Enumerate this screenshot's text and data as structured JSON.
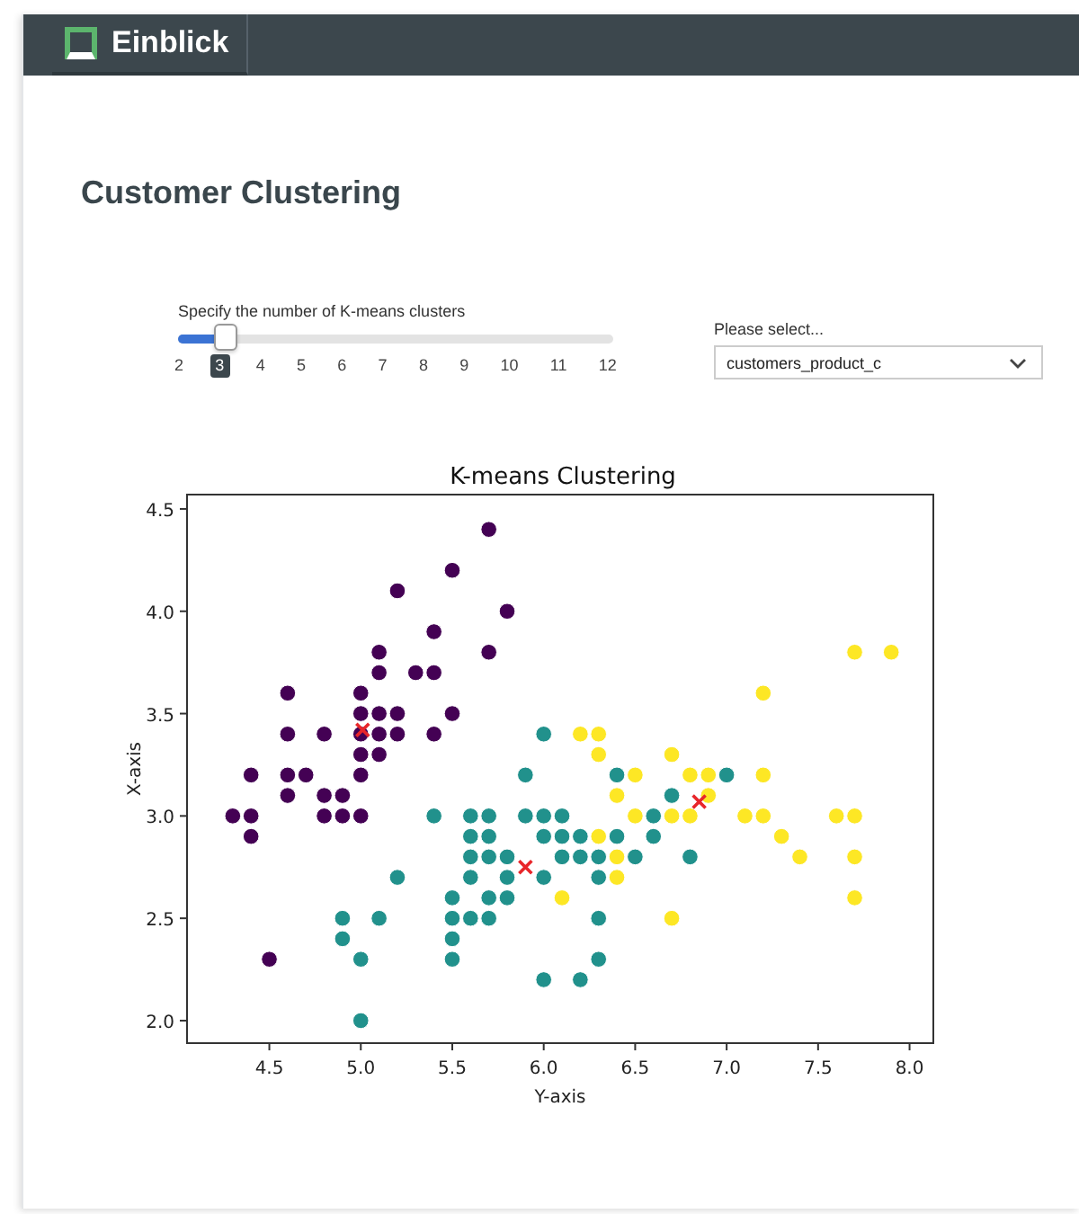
{
  "header": {
    "brand": "Einblick"
  },
  "page": {
    "title": "Customer Clustering"
  },
  "slider": {
    "label": "Specify the number of K-means clusters",
    "level": 0.1,
    "ticks": [
      {
        "label": "2",
        "selected": false
      },
      {
        "label": "3",
        "selected": true
      },
      {
        "label": "4",
        "selected": false
      },
      {
        "label": "5",
        "selected": false
      },
      {
        "label": "6",
        "selected": false
      },
      {
        "label": "7",
        "selected": false
      },
      {
        "label": "8",
        "selected": false
      },
      {
        "label": "9",
        "selected": false
      },
      {
        "label": "10",
        "selected": false
      },
      {
        "label": "11",
        "selected": false
      },
      {
        "label": "12",
        "selected": false
      }
    ]
  },
  "dropdown": {
    "label": "Please select...",
    "value": "customers_product_c"
  },
  "chart": {
    "chart_data": {
      "type": "scatter",
      "title": "K-means Clustering",
      "xlabel": "Y-axis",
      "ylabel": "X-axis",
      "xlim": [
        4.05,
        8.13
      ],
      "ylim": [
        1.89,
        4.57
      ],
      "xticks": [
        {
          "value": 4.5,
          "label": "4.5"
        },
        {
          "value": 5,
          "label": "5.0"
        },
        {
          "value": 5.5,
          "label": "5.5"
        },
        {
          "value": 6,
          "label": "6.0"
        },
        {
          "value": 6.5,
          "label": "6.5"
        },
        {
          "value": 7,
          "label": "7.0"
        },
        {
          "value": 7.5,
          "label": "7.5"
        },
        {
          "value": 8,
          "label": "8.0"
        }
      ],
      "yticks": [
        {
          "value": 2,
          "label": "2.0"
        },
        {
          "value": 2.5,
          "label": "2.5"
        },
        {
          "value": 3,
          "label": "3.0"
        },
        {
          "value": 3.5,
          "label": "3.5"
        },
        {
          "value": 4,
          "label": "4.0"
        },
        {
          "value": 4.5,
          "label": "4.5"
        }
      ],
      "series": [
        {
          "marker": "o",
          "color": "#440154",
          "x": [
            4.3,
            4.4,
            4.4,
            4.4,
            4.5,
            4.6,
            4.6,
            4.6,
            4.6,
            4.7,
            4.8,
            4.8,
            4.8,
            4.9,
            4.9,
            5.0,
            5.0,
            5.0,
            5.0,
            5.0,
            5.0,
            5.1,
            5.1,
            5.1,
            5.1,
            5.1,
            5.2,
            5.2,
            5.2,
            5.3,
            5.4,
            5.4,
            5.4,
            5.5,
            5.5,
            5.7,
            5.7,
            5.8
          ],
          "values": [
            3.0,
            3.0,
            2.9,
            3.2,
            2.3,
            3.6,
            3.4,
            3.2,
            3.1,
            3.2,
            3.4,
            3.1,
            3.0,
            3.1,
            3.0,
            3.0,
            3.2,
            3.3,
            3.4,
            3.5,
            3.6,
            3.4,
            3.5,
            3.3,
            3.7,
            3.8,
            3.5,
            3.4,
            4.1,
            3.7,
            3.7,
            3.9,
            3.4,
            4.2,
            3.5,
            4.4,
            3.8,
            4.0
          ]
        },
        {
          "marker": "o",
          "color": "#21918c",
          "x": [
            4.9,
            4.9,
            5.0,
            5.0,
            5.1,
            5.2,
            5.4,
            5.5,
            5.5,
            5.5,
            5.5,
            5.6,
            5.6,
            5.6,
            5.6,
            5.6,
            5.7,
            5.7,
            5.7,
            5.7,
            5.7,
            5.8,
            5.8,
            5.8,
            5.9,
            5.9,
            6.0,
            6.0,
            6.0,
            6.0,
            6.0,
            6.1,
            6.1,
            6.1,
            6.2,
            6.2,
            6.2,
            6.3,
            6.3,
            6.3,
            6.3,
            6.4,
            6.4,
            6.5,
            6.6,
            6.6,
            6.7,
            6.8,
            7.0
          ],
          "values": [
            2.5,
            2.4,
            2.3,
            2.0,
            2.5,
            2.7,
            3.0,
            2.6,
            2.5,
            2.4,
            2.3,
            3.0,
            2.9,
            2.8,
            2.7,
            2.5,
            3.0,
            2.9,
            2.8,
            2.6,
            2.5,
            2.8,
            2.7,
            2.6,
            3.2,
            3.0,
            3.4,
            3.0,
            2.9,
            2.7,
            2.2,
            3.0,
            2.9,
            2.8,
            2.9,
            2.8,
            2.2,
            2.8,
            2.7,
            2.5,
            2.3,
            3.2,
            2.9,
            2.8,
            3.0,
            2.9,
            3.1,
            2.8,
            3.2
          ]
        },
        {
          "marker": "o",
          "color": "#fde725",
          "x": [
            6.1,
            6.2,
            6.3,
            6.3,
            6.3,
            6.4,
            6.4,
            6.4,
            6.5,
            6.5,
            6.7,
            6.7,
            6.7,
            6.8,
            6.8,
            6.9,
            6.9,
            7.1,
            7.2,
            7.2,
            7.2,
            7.3,
            7.4,
            7.6,
            7.7,
            7.7,
            7.7,
            7.7,
            7.9
          ],
          "values": [
            2.6,
            3.4,
            3.4,
            3.3,
            2.9,
            3.1,
            2.8,
            2.7,
            3.2,
            3.0,
            3.3,
            3.0,
            2.5,
            3.2,
            3.0,
            3.2,
            3.1,
            3.0,
            3.6,
            3.2,
            3.0,
            2.9,
            2.8,
            3.0,
            3.8,
            3.0,
            2.8,
            2.6,
            3.8
          ]
        },
        {
          "marker": "x",
          "color": "#e8262a",
          "x": [
            5.01,
            5.9,
            6.85
          ],
          "values": [
            3.42,
            2.75,
            3.07
          ]
        }
      ]
    }
  }
}
